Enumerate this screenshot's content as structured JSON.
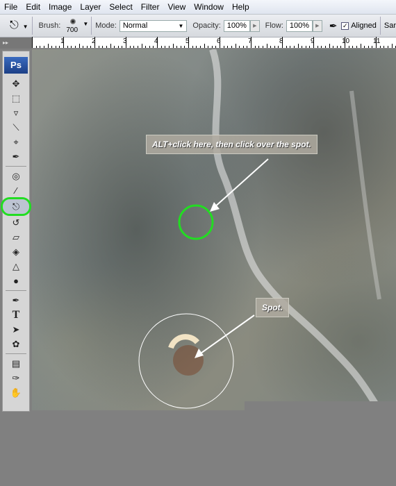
{
  "menu": [
    "File",
    "Edit",
    "Image",
    "Layer",
    "Select",
    "Filter",
    "View",
    "Window",
    "Help"
  ],
  "options": {
    "brush_label": "Brush:",
    "brush_size": "700",
    "mode_label": "Mode:",
    "mode_value": "Normal",
    "opacity_label": "Opacity:",
    "opacity_value": "100%",
    "flow_label": "Flow:",
    "flow_value": "100%",
    "aligned_label": "Aligned",
    "aligned_checked": true,
    "sample_label": "Sar"
  },
  "ruler": [
    "1",
    "2",
    "3",
    "4",
    "5",
    "6",
    "7",
    "8",
    "9",
    "10",
    "11"
  ],
  "toolbar": {
    "logo": "Ps",
    "active_tool": "clone-stamp",
    "highlight_color": "#22dd22"
  },
  "annotations": {
    "callout_1": "ALT+click here, then click over the spot.",
    "callout_2": "Spot."
  }
}
